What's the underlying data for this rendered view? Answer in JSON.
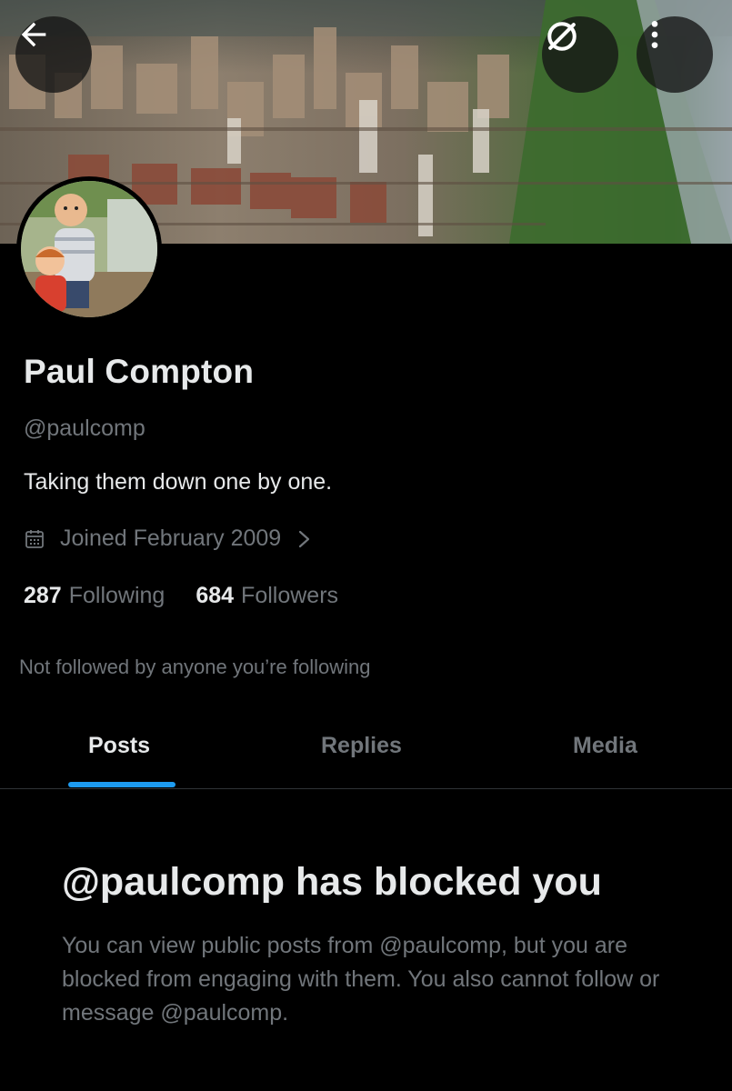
{
  "header": {
    "back_icon": "arrow-left-icon",
    "hide_icon": "eye-slash-circle-icon",
    "more_icon": "more-vertical-icon"
  },
  "profile": {
    "name": "Paul Compton",
    "handle": "@paulcomp",
    "bio": "Taking them down one by one.",
    "joined": "Joined February 2009",
    "following_count": "287",
    "following_label": "Following",
    "followers_count": "684",
    "followers_label": "Followers",
    "not_followed": "Not followed by anyone you’re following"
  },
  "tabs": [
    {
      "label": "Posts",
      "active": true
    },
    {
      "label": "Replies",
      "active": false
    },
    {
      "label": "Media",
      "active": false
    }
  ],
  "blocked": {
    "title": "@paulcomp has blocked you",
    "description": "You can view public posts from @paulcomp, but you are blocked from engaging with them. You also cannot follow or message @paulcomp."
  },
  "colors": {
    "background": "#000000",
    "text_primary": "#e7e9ea",
    "text_secondary": "#71767b",
    "accent": "#1d9bf0",
    "divider": "#2f3336"
  }
}
